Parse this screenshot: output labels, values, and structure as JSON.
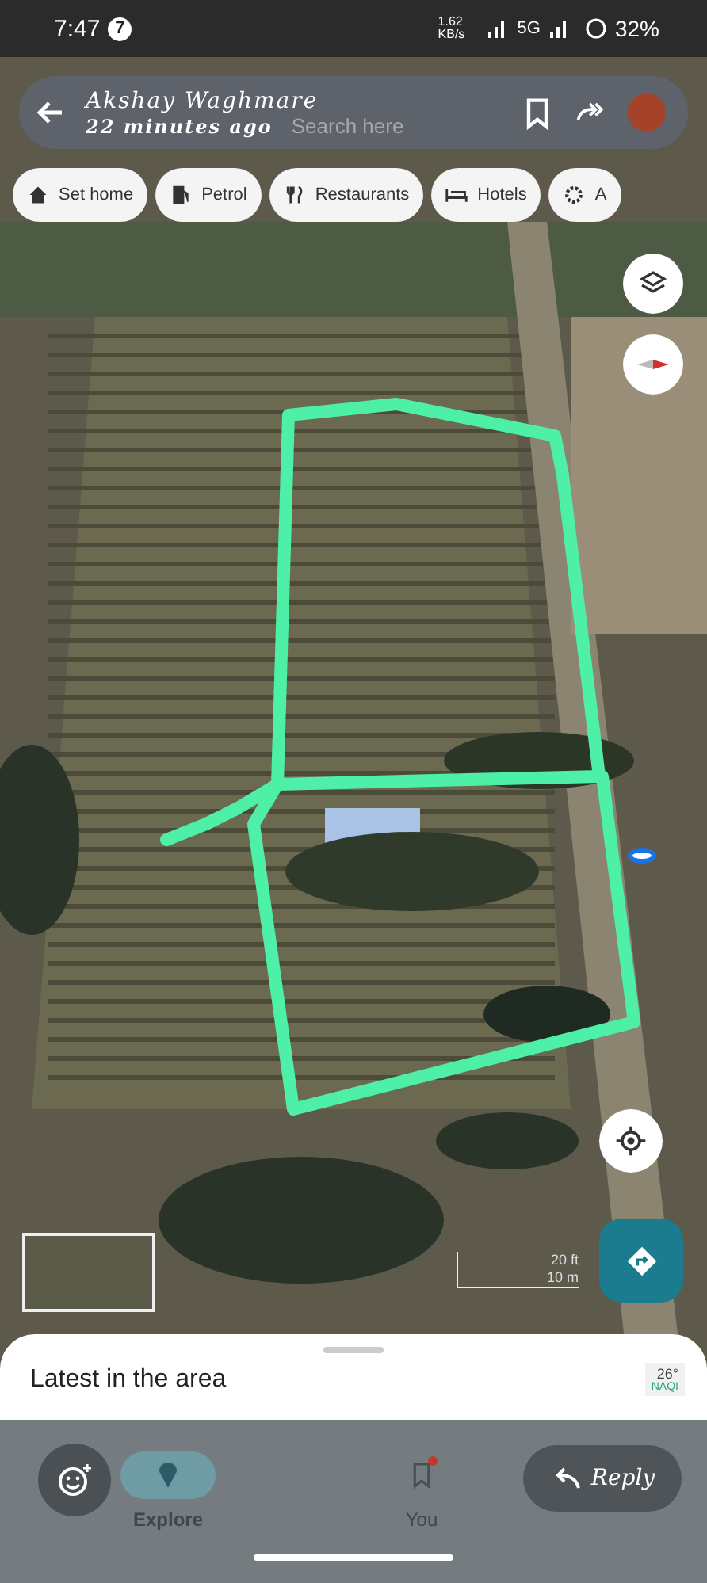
{
  "status_bar": {
    "time": "7:47",
    "notification_count": "7",
    "net_speed": "1.62 KB/s",
    "network": "5G",
    "battery": "32%"
  },
  "status_viewer": {
    "name": "Akshay Waghmare",
    "time_ago": "22 minutes ago"
  },
  "search": {
    "placeholder": "Search here"
  },
  "chips": [
    {
      "label": "Set home",
      "kind": "home"
    },
    {
      "label": "Petrol",
      "kind": "fuel"
    },
    {
      "label": "Restaurants",
      "kind": "food"
    },
    {
      "label": "Hotels",
      "kind": "bed"
    },
    {
      "label": "A",
      "kind": "gear"
    }
  ],
  "scale": {
    "feet": "20 ft",
    "meters": "10 m"
  },
  "sheet": {
    "title": "Latest in the area",
    "temperature": "26°",
    "aqi": "NAQI"
  },
  "nav": [
    {
      "label": "Explore",
      "selected": true,
      "badge": false
    },
    {
      "label": "You",
      "selected": false,
      "badge": true
    }
  ],
  "reply": {
    "label": "Reply"
  }
}
